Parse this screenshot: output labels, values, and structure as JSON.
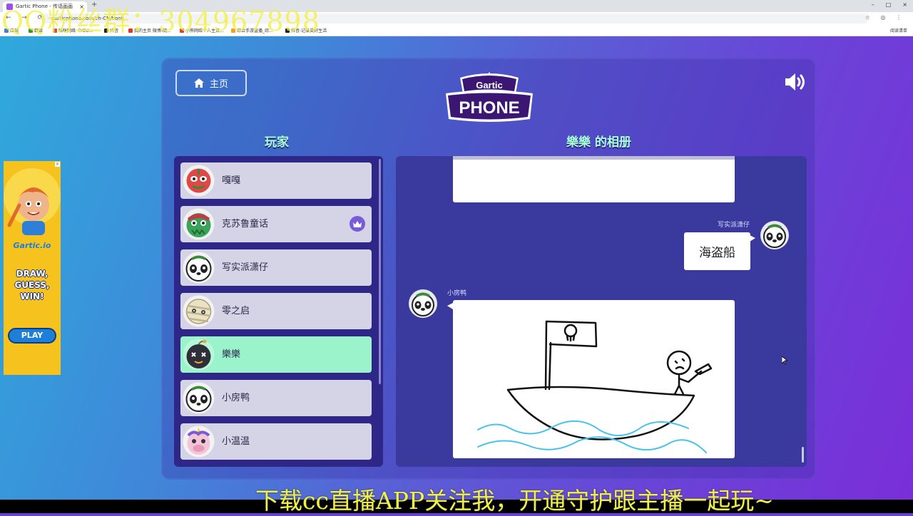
{
  "browser": {
    "tab_title": "Gartic Phone - 传话画画",
    "tab_close": "×",
    "new_tab": "+",
    "window_controls": [
      "–",
      "□",
      "×"
    ],
    "nav_icons": "← → ⟳",
    "url": "garticphone.com/zh-CN/book",
    "right_icons": "☆ ◎ ⋮",
    "bookmarks": [
      {
        "label": "应用",
        "color": "#4a7bd8"
      },
      {
        "label": "翻译",
        "color": "#3b8d3b"
      },
      {
        "label": "咪咪网络（YOU...",
        "color": "#d84a4a"
      },
      {
        "label": "抖音",
        "color": "#222222"
      },
      {
        "label": "我的主页 微博-随...",
        "color": "#d8392b"
      },
      {
        "label": "小熊网络个人主页...",
        "color": "#e23d3d"
      },
      {
        "label": "综合手游直播_综...",
        "color": "#f1a226"
      },
      {
        "label": "抖音-记录美好生活",
        "color": "#222222"
      }
    ],
    "bookmarks_right": "阅读清单"
  },
  "overlay": {
    "qq_group": "QQ粉丝群：304967898",
    "subtitle": "下载cc直播APP关注我，开通守护跟主播一起玩~"
  },
  "header": {
    "home_label": "主页",
    "logo_top": "Gartic",
    "logo_bottom": "PHONE"
  },
  "players": {
    "title": "玩家",
    "list": [
      {
        "name": "嘎嘎",
        "avatar": "luchador",
        "host": false,
        "active": false
      },
      {
        "name": "克苏鲁童话",
        "avatar": "green-monster",
        "host": true,
        "active": false
      },
      {
        "name": "写实派潇仔",
        "avatar": "panda",
        "host": false,
        "active": false
      },
      {
        "name": "零之启",
        "avatar": "mummy",
        "host": false,
        "active": false
      },
      {
        "name": "樂樂",
        "avatar": "bomb",
        "host": false,
        "active": true
      },
      {
        "name": "小房鸭",
        "avatar": "panda",
        "host": false,
        "active": false
      },
      {
        "name": "小温温",
        "avatar": "unicorn",
        "host": false,
        "active": false
      }
    ]
  },
  "album": {
    "title": "樂樂 的相册",
    "text_entry": {
      "author": "写实派潇仔",
      "text": "海盗船"
    },
    "drawing_entry": {
      "author": "小房鸭"
    }
  },
  "ad": {
    "logo": "Gartic.io",
    "lines": [
      "DRAW,",
      "GUESS,",
      "WIN!"
    ],
    "play": "PLAY",
    "close": "×"
  }
}
